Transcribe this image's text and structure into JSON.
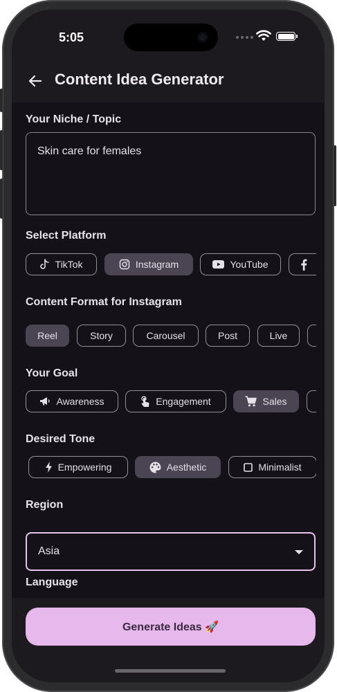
{
  "status": {
    "time": "5:05"
  },
  "appbar": {
    "title": "Content Idea Generator"
  },
  "niche": {
    "label": "Your Niche / Topic",
    "value": "Skin care for females"
  },
  "platform": {
    "label": "Select Platform",
    "items": [
      {
        "label": "TikTok",
        "icon": "tiktok-icon",
        "selected": false
      },
      {
        "label": "Instagram",
        "icon": "instagram-icon",
        "selected": true
      },
      {
        "label": "YouTube",
        "icon": "youtube-icon",
        "selected": false
      },
      {
        "label": "",
        "icon": "facebook-icon",
        "selected": false
      }
    ]
  },
  "format": {
    "label": "Content Format for Instagram",
    "items": [
      {
        "label": "Reel",
        "selected": true
      },
      {
        "label": "Story",
        "selected": false
      },
      {
        "label": "Carousel",
        "selected": false
      },
      {
        "label": "Post",
        "selected": false
      },
      {
        "label": "Live",
        "selected": false
      }
    ]
  },
  "goal": {
    "label": "Your Goal",
    "items": [
      {
        "label": "Awareness",
        "icon": "megaphone-icon",
        "selected": false
      },
      {
        "label": "Engagement",
        "icon": "touch-icon",
        "selected": false
      },
      {
        "label": "Sales",
        "icon": "cart-icon",
        "selected": true
      }
    ]
  },
  "tone": {
    "label": "Desired Tone",
    "items": [
      {
        "label": "Empowering",
        "icon": "bolt-icon",
        "selected": false
      },
      {
        "label": "Aesthetic",
        "icon": "palette-icon",
        "selected": true
      },
      {
        "label": "Minimalist",
        "icon": "square-icon",
        "selected": false
      }
    ]
  },
  "region": {
    "label": "Region",
    "value": "Asia"
  },
  "language": {
    "label": "Language"
  },
  "generate": {
    "label": "Generate Ideas 🚀"
  },
  "colors": {
    "accent": "#e6b8ec",
    "selected_chip": "#4b4452",
    "background": "#141218",
    "border": "#948e98"
  }
}
